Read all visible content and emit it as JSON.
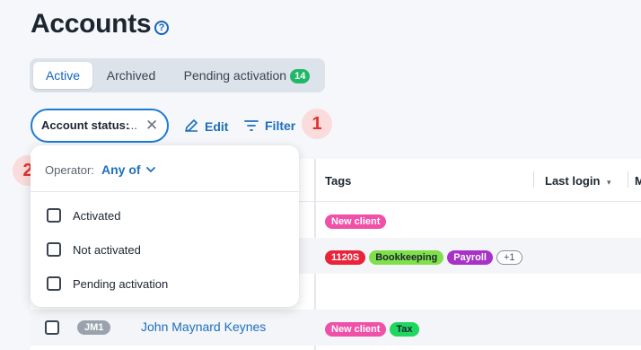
{
  "page": {
    "title": "Accounts"
  },
  "tabs": [
    {
      "label": "Active"
    },
    {
      "label": "Archived"
    },
    {
      "label": "Pending activation",
      "badge": "14"
    }
  ],
  "filter_chip": {
    "label": "Account status:",
    "ellipsis": "..."
  },
  "toolbar": {
    "edit_label": "Edit",
    "filter_label": "Filter"
  },
  "steps": [
    "1",
    "2"
  ],
  "table": {
    "headers": {
      "tags": "Tags",
      "last_login": "Last login",
      "next": "M"
    },
    "rows": [
      {
        "tags": [
          {
            "text": "New client",
            "bg": "#f050a8",
            "fg": "#ffffff"
          }
        ]
      },
      {
        "tags": [
          {
            "text": "1120S",
            "bg": "#e8233a",
            "fg": "#ffffff"
          },
          {
            "text": "Bookkeeping",
            "bg": "#7fe04a",
            "fg": "#1c2530"
          },
          {
            "text": "Payroll",
            "bg": "#a832c8",
            "fg": "#ffffff"
          },
          {
            "text": "+1",
            "outline": true
          }
        ]
      },
      {
        "tags": []
      },
      {
        "initials": "JM1",
        "name": "John Maynard Keynes",
        "tags": [
          {
            "text": "New client",
            "bg": "#f050a8",
            "fg": "#ffffff"
          },
          {
            "text": "Tax",
            "bg": "#1ed760",
            "fg": "#1c2530"
          }
        ]
      }
    ]
  },
  "dropdown": {
    "operator_label": "Operator:",
    "operator_value": "Any of",
    "options": [
      "Activated",
      "Not activated",
      "Pending activation"
    ]
  }
}
